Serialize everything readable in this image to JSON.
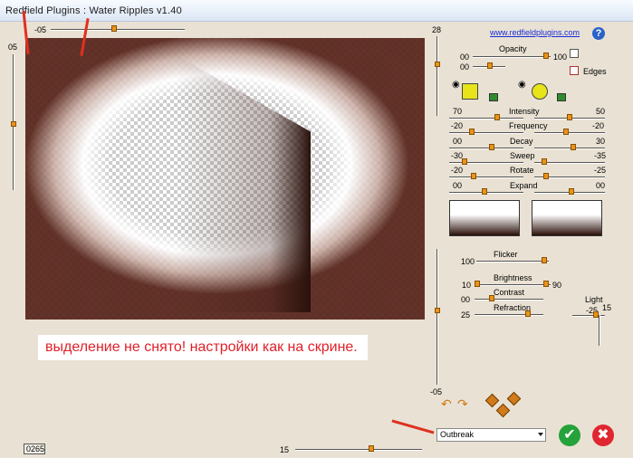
{
  "window": {
    "title": "Redfield Plugins : Water Ripples v1.40"
  },
  "preview": {
    "caption": "выделение не снято! настройки как на скрине.",
    "top_slider_value": "-05",
    "left_slider_value": "05",
    "bottom_slider_value": "15",
    "frame_counter": "0265"
  },
  "panel": {
    "link": "www.redfieldplugins.com",
    "help": "?",
    "top_vertical_value": "28",
    "bottom_vertical_value": "-05",
    "opacity": {
      "label": "Opacity",
      "min": "00",
      "max": "100",
      "second_min": "00"
    },
    "edges_label": "Edges",
    "sliders": [
      {
        "label": "Intensity",
        "left": "70",
        "right": "50"
      },
      {
        "label": "Frequency",
        "left": "-20",
        "right": "-20"
      },
      {
        "label": "Decay",
        "left": "00",
        "right": "30"
      },
      {
        "label": "Sweep",
        "left": "-30",
        "right": "-35"
      },
      {
        "label": "Rotate",
        "left": "-20",
        "right": "-25"
      },
      {
        "label": "Expand",
        "left": "00",
        "right": "00"
      }
    ],
    "flicker": {
      "label": "Flicker",
      "value": "100"
    },
    "brightness": {
      "label": "Brightness",
      "left": "10",
      "right": "90"
    },
    "contrast": {
      "label": "Contrast",
      "value": "00"
    },
    "refraction": {
      "label": "Refraction",
      "value": "25"
    },
    "light": {
      "label": "Light",
      "left": "-25",
      "right": "15"
    },
    "mode_select": "Outbreak",
    "ok": "✔",
    "cancel": "✖"
  }
}
